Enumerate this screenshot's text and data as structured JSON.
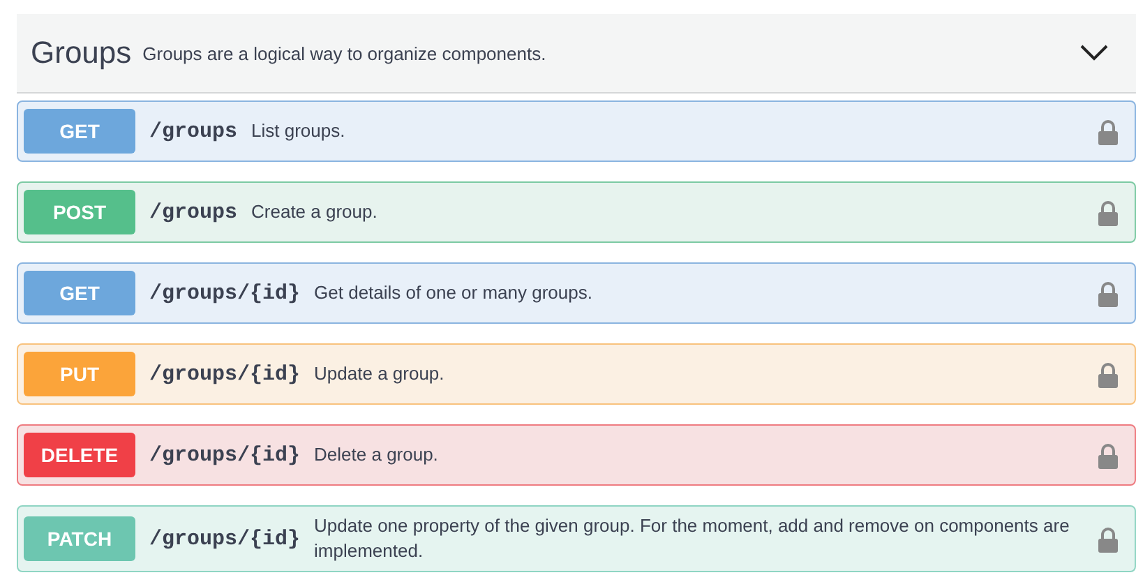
{
  "section": {
    "title": "Groups",
    "description": "Groups are a logical way to organize components.",
    "expanded": true
  },
  "operations": [
    {
      "kind": "get",
      "label": "GET",
      "path": "/groups",
      "summary": "List groups.",
      "locked": true
    },
    {
      "kind": "post",
      "label": "POST",
      "path": "/groups",
      "summary": "Create a group.",
      "locked": true
    },
    {
      "kind": "get",
      "label": "GET",
      "path": "/groups/{id}",
      "summary": "Get details of one or many groups.",
      "locked": true
    },
    {
      "kind": "put",
      "label": "PUT",
      "path": "/groups/{id}",
      "summary": "Update a group.",
      "locked": true
    },
    {
      "kind": "delete",
      "label": "DELETE",
      "path": "/groups/{id}",
      "summary": "Delete a group.",
      "locked": true
    },
    {
      "kind": "patch",
      "label": "PATCH",
      "path": "/groups/{id}",
      "summary": "Update one property of the given group. For the moment, add and remove on components are implemented.",
      "locked": true
    }
  ]
}
